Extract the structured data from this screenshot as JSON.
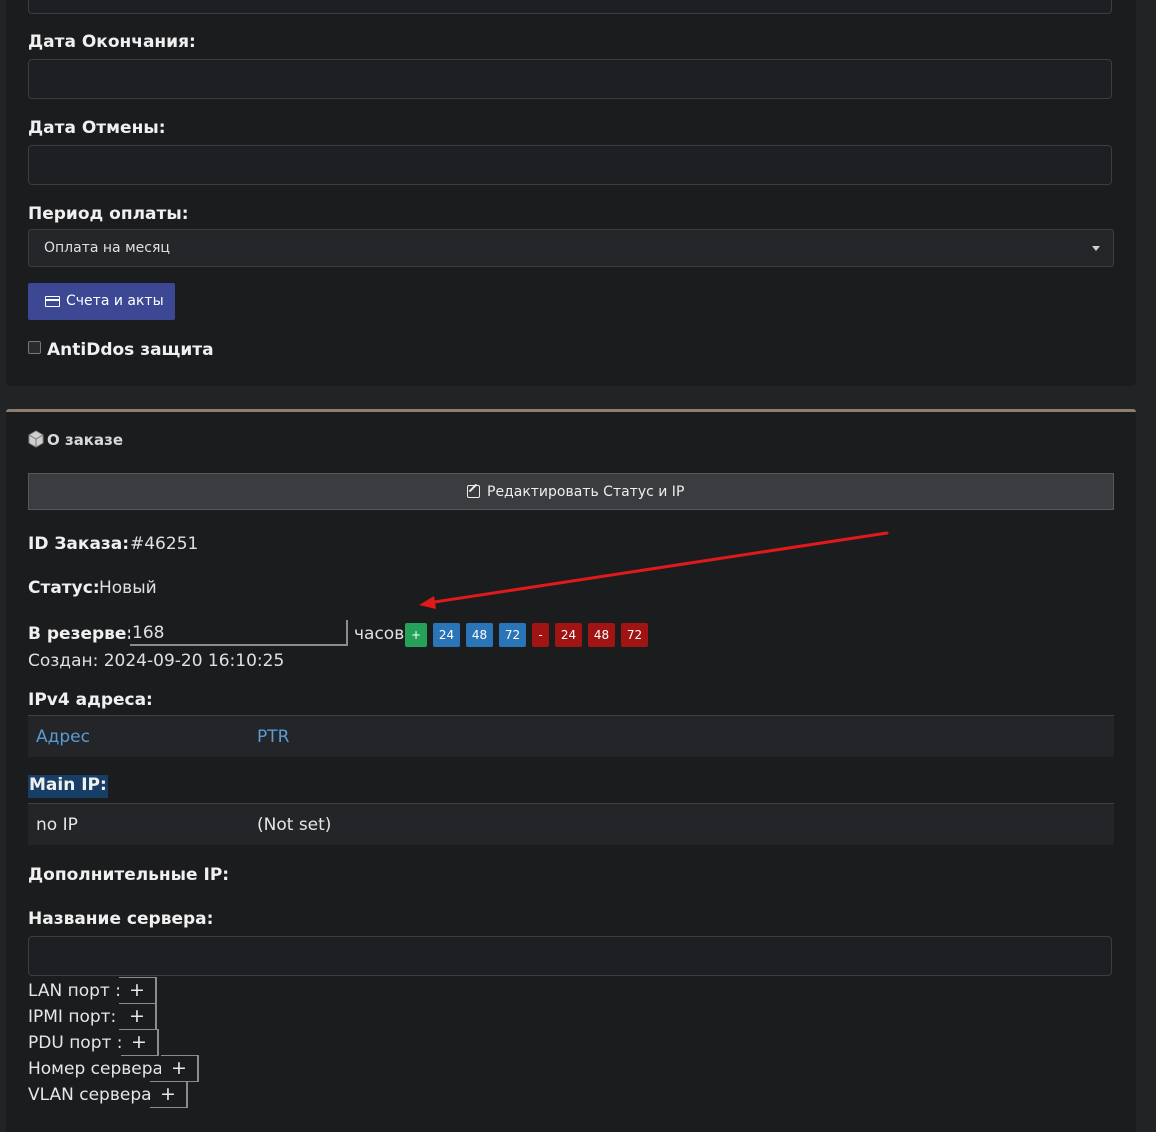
{
  "form": {
    "end_date_label": "Дата Окончания:",
    "cancel_date_label": "Дата Отмены:",
    "payment_period_label": "Период оплаты:",
    "payment_period_value": "Оплата на месяц",
    "invoices_button": "Счета и акты",
    "antiddos_label": "AntiDdos защита"
  },
  "order": {
    "section_title": "О заказе",
    "edit_button": "Редактировать Статус и IP",
    "id_label": "ID Заказа:",
    "id_value": "#46251",
    "status_label": "Статус:",
    "status_value": "Новый",
    "reserve_label": "В резерве:",
    "reserve_value": "168",
    "reserve_unit": "часов",
    "reserve_chips": [
      "+",
      "24",
      "48",
      "72",
      "-",
      "24",
      "48",
      "72"
    ],
    "created": "Создан: 2024-09-20 16:10:25",
    "ipv4_label": "IPv4 адреса:",
    "ip_table_headers": [
      "Адрес",
      "PTR"
    ],
    "main_ip_label": "Main IP:",
    "main_ip_row": [
      "no IP",
      "(Not set)"
    ],
    "additional_ip_label": "Дополнительные IP:",
    "server_name_label": "Название сервера:",
    "ports": [
      {
        "label": "LAN порт :",
        "button": "+"
      },
      {
        "label": "IPMI порт:",
        "button": "+"
      },
      {
        "label": "PDU порт :",
        "button": "+"
      },
      {
        "label": "Номер сервера:",
        "button": "+"
      },
      {
        "label": "VLAN сервера:",
        "button": "+"
      }
    ]
  },
  "colors": {
    "background": "#222325",
    "panel": "#1b1c1e",
    "primary_button": "#3c4894",
    "chip_green": "#25a15a",
    "chip_blue": "#2a74b8",
    "chip_red": "#a01414",
    "link": "#5a9bd5",
    "annotation_arrow": "#e01a1a"
  }
}
